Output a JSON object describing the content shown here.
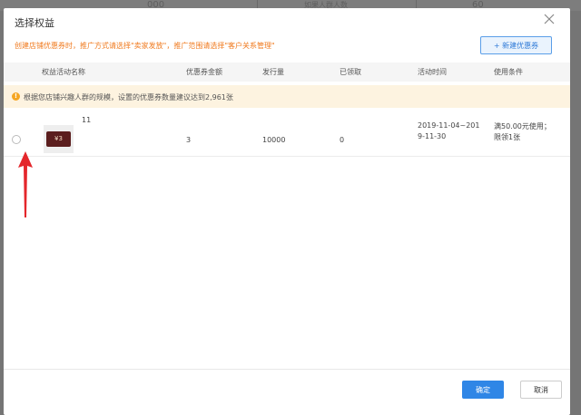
{
  "background": {
    "ghost_text_1": "000",
    "ghost_text_2": "如果人群人数",
    "ghost_text_3": "60"
  },
  "modal": {
    "title": "选择权益",
    "notice": "创建店铺优惠券时，推广方式请选择\"卖家发放\"，推广范围请选择\"客户关系管理\"",
    "new_button_label": "+ 新建优惠券",
    "table": {
      "headers": [
        "权益活动名称",
        "优惠券金额",
        "发行量",
        "已领取",
        "活动时间",
        "使用条件"
      ],
      "tip": "根据您店铺兴趣人群的规模，设置的优惠券数量建议达到2,961张",
      "rows": [
        {
          "name": "11",
          "coupon_face": "¥3",
          "amount": "3",
          "issued": "10000",
          "claimed": "0",
          "time_line1": "2019-11-04~201",
          "time_line2": "9-11-30",
          "cond_line1": "满50.00元使用；",
          "cond_line2": "限领1张"
        }
      ]
    },
    "confirm_label": "确定",
    "cancel_label": "取消"
  },
  "colors": {
    "accent": "#2f86e6",
    "notice": "#f07a1e",
    "tip_bg": "#fdf3e0",
    "arrow": "#e4262b"
  }
}
